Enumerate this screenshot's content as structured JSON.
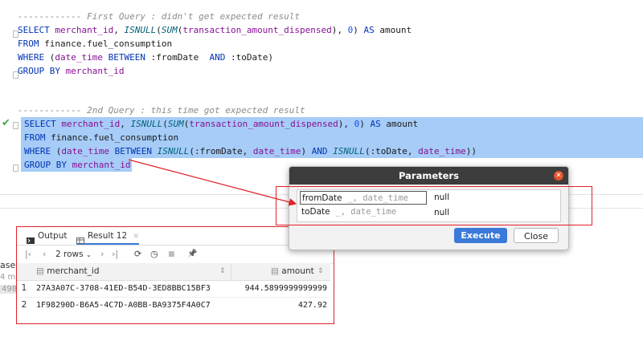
{
  "editor": {
    "lines": {
      "c1": "------------ First Query : didn't get expected result",
      "q1": {
        "select": "SELECT ",
        "col1": "merchant_id",
        "comma1": ", ",
        "isnull": "ISNULL",
        "p1": "(",
        "sum": "SUM",
        "p2": "(",
        "col2": "transaction_amount_dispensed",
        "p3": "), ",
        "zero": "0",
        "p4": ") ",
        "as": "AS",
        "alias": " amount"
      },
      "from1": {
        "kw": "FROM",
        "table": " finance.fuel_consumption"
      },
      "where1": {
        "kw": "WHERE",
        "p1": " (",
        "col": "date_time",
        "between": " BETWEEN ",
        "from": ":fromDate",
        "and": "  AND ",
        "to": ":toDate",
        "p2": ")"
      },
      "group1": {
        "kw": "GROUP BY",
        "col": " merchant_id"
      },
      "c2": "------------ 2nd Query : this time got expected result",
      "q2": {
        "select": "SELECT ",
        "col1": "merchant_id",
        "comma1": ", ",
        "isnull": "ISNULL",
        "p1": "(",
        "sum": "SUM",
        "p2": "(",
        "col2": "transaction_amount_dispensed",
        "p3": "), ",
        "zero": "0",
        "p4": ") ",
        "as": "AS",
        "alias": " amount"
      },
      "from2": {
        "kw": "FROM",
        "table": " finance.fuel_consumption"
      },
      "where2": {
        "kw": "WHERE",
        "p1": " (",
        "col": "date_time",
        "between": " BETWEEN ",
        "isnull1": "ISNULL",
        "a1": "(",
        "from": ":fromDate",
        "a2": ", ",
        "col2": "date_time",
        "a3": ") ",
        "and": "AND ",
        "isnull2": "ISNULL",
        "b1": "(",
        "to": ":toDate",
        "b2": ", ",
        "col3": "date_time",
        "b3": "))"
      },
      "group2": {
        "kw": "GROUP BY",
        "col": " merchant_id"
      }
    }
  },
  "side": {
    "frag1": "ase",
    "frag2": "4 ms",
    "frag3": "498"
  },
  "results": {
    "tabs": {
      "output": "Output",
      "result": "Result 12",
      "close": "✕"
    },
    "toolbar": {
      "first": "|‹",
      "prev": "‹",
      "rows": "2 rows",
      "next": "›",
      "last": "›|",
      "refresh": "⟳",
      "history": "◷",
      "stop": "■",
      "pin": "📌"
    },
    "columns": {
      "merchant": "merchant_id",
      "amount": "amount",
      "sort": "⇕"
    },
    "rows": [
      {
        "num": "1",
        "merchant_id": "27A3A07C-3708-41ED-B54D-3ED8BBC15BF3",
        "amount": "944.5899999999999"
      },
      {
        "num": "2",
        "merchant_id": "1F98290D-B6A5-4C7D-A0BB-BA9375F4A0C7",
        "amount": "427.92"
      }
    ]
  },
  "dialog": {
    "title": "Parameters",
    "params": [
      {
        "name": "fromDate",
        "type": "_, date_time",
        "value": "null"
      },
      {
        "name": "toDate",
        "type": "_, date_time",
        "value": "null"
      }
    ],
    "execute_label": "Execute",
    "close_label": "Close"
  },
  "colors": {
    "accent": "#3b7ad8",
    "selection": "#a6ccf7",
    "annotation": "#e0222a",
    "titlebar": "#3c3c3c"
  }
}
